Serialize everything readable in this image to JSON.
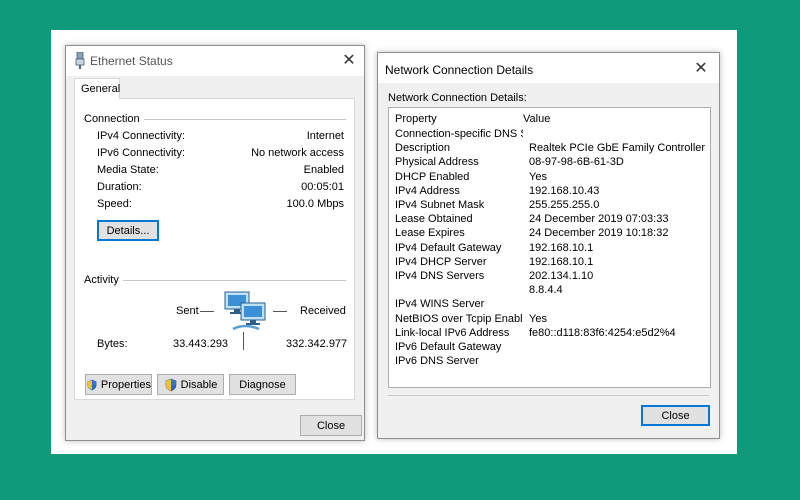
{
  "ethernet_status": {
    "title": "Ethernet Status",
    "tab_general": "General",
    "connection_group": "Connection",
    "rows": [
      {
        "label": "IPv4 Connectivity:",
        "value": "Internet"
      },
      {
        "label": "IPv6 Connectivity:",
        "value": "No network access"
      },
      {
        "label": "Media State:",
        "value": "Enabled"
      },
      {
        "label": "Duration:",
        "value": "00:05:01"
      },
      {
        "label": "Speed:",
        "value": "100.0 Mbps"
      }
    ],
    "details_button": "Details...",
    "activity_group": "Activity",
    "sent_label": "Sent",
    "received_label": "Received",
    "bytes_label": "Bytes:",
    "bytes_sent": "33.443.293",
    "bytes_received": "332.342.977",
    "properties_button": "Properties",
    "disable_button": "Disable",
    "diagnose_button": "Diagnose",
    "close_button": "Close"
  },
  "details_dialog": {
    "title": "Network Connection Details",
    "list_caption": "Network Connection Details:",
    "header_property": "Property",
    "header_value": "Value",
    "rows": [
      {
        "property": "Connection-specific DNS S...",
        "value": ""
      },
      {
        "property": "Description",
        "value": "Realtek PCIe GbE Family Controller"
      },
      {
        "property": "Physical Address",
        "value": "08-97-98-6B-61-3D"
      },
      {
        "property": "DHCP Enabled",
        "value": "Yes"
      },
      {
        "property": "IPv4 Address",
        "value": "192.168.10.43"
      },
      {
        "property": "IPv4 Subnet Mask",
        "value": "255.255.255.0"
      },
      {
        "property": "Lease Obtained",
        "value": "24 December 2019 07:03:33"
      },
      {
        "property": "Lease Expires",
        "value": "24 December 2019 10:18:32"
      },
      {
        "property": "IPv4 Default Gateway",
        "value": "192.168.10.1"
      },
      {
        "property": "IPv4 DHCP Server",
        "value": "192.168.10.1"
      },
      {
        "property": "IPv4 DNS Servers",
        "value": "202.134.1.10"
      },
      {
        "property": "",
        "value": "8.8.4.4"
      },
      {
        "property": "IPv4 WINS Server",
        "value": ""
      },
      {
        "property": "NetBIOS over Tcpip Enabl...",
        "value": "Yes"
      },
      {
        "property": "Link-local IPv6 Address",
        "value": "fe80::d118:83f6:4254:e5d2%4"
      },
      {
        "property": "IPv6 Default Gateway",
        "value": ""
      },
      {
        "property": "IPv6 DNS Server",
        "value": ""
      }
    ],
    "close_button": "Close"
  },
  "colors": {
    "background": "#0f9b7a",
    "panel": "#ffffff",
    "window_face": "#f0f0f0",
    "focus_blue": "#0078d7"
  }
}
